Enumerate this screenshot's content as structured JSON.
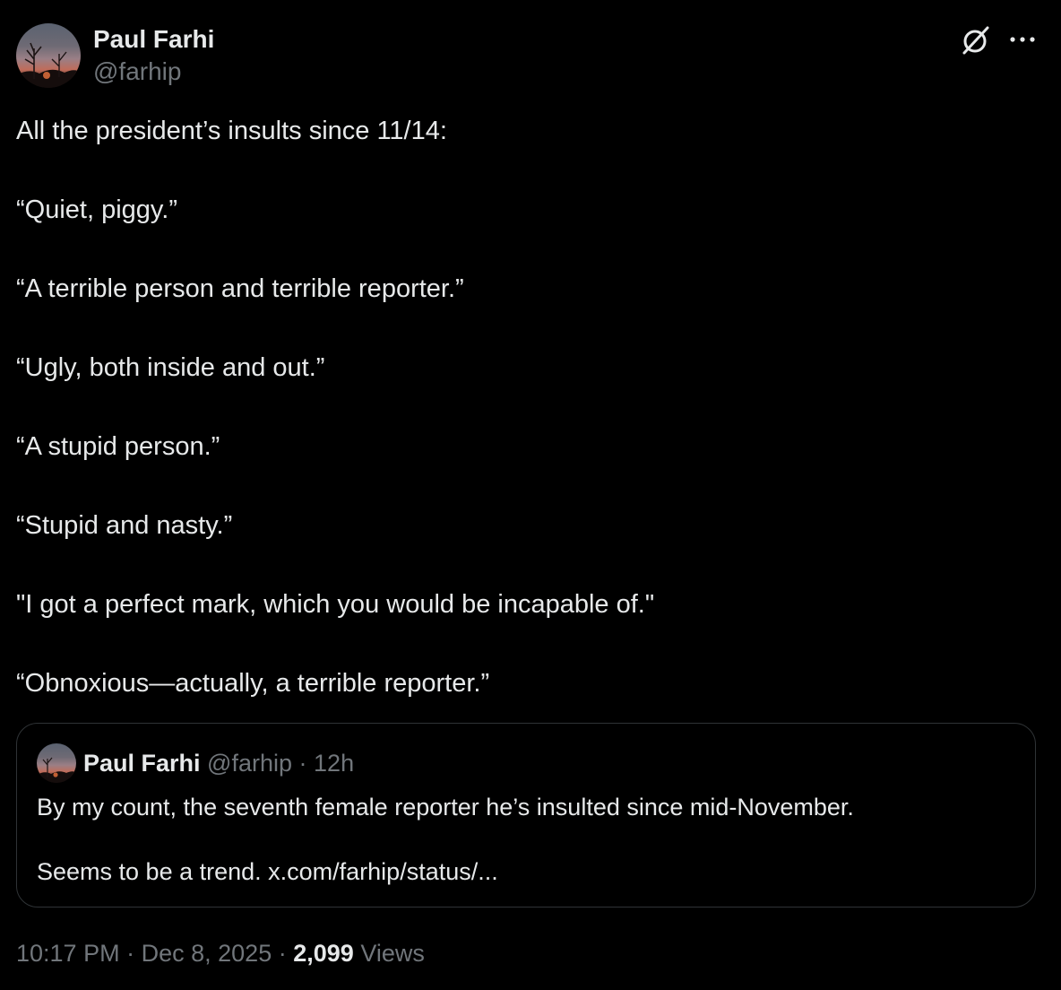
{
  "author": {
    "name": "Paul Farhi",
    "handle": "@farhip"
  },
  "icons": {
    "grok": "grok-icon",
    "more": "more-icon"
  },
  "tweet": {
    "lines": [
      "All the president’s insults since 11/14:",
      "“Quiet, piggy.”",
      "“A terrible person and terrible reporter.”",
      "“Ugly, both inside and out.”",
      "“A stupid person.”",
      "“Stupid and nasty.”",
      "\"I got a perfect mark, which you would be incapable of.\"",
      "“Obnoxious—actually, a terrible reporter.”"
    ]
  },
  "quoted": {
    "name": "Paul Farhi",
    "handle": "@farhip",
    "separator": "·",
    "time": "12h",
    "lines": [
      "By my count, the seventh female reporter he’s insulted since mid-November.",
      "Seems to be a trend. x.com/farhip/status/..."
    ]
  },
  "meta": {
    "time": "10:17 PM",
    "separator": "·",
    "date": "Dec 8, 2025",
    "views_count": "2,099",
    "views_label": "Views"
  },
  "colors": {
    "background": "#000000",
    "text": "#e7e9ea",
    "muted": "#71767b",
    "border": "#2f3336"
  }
}
